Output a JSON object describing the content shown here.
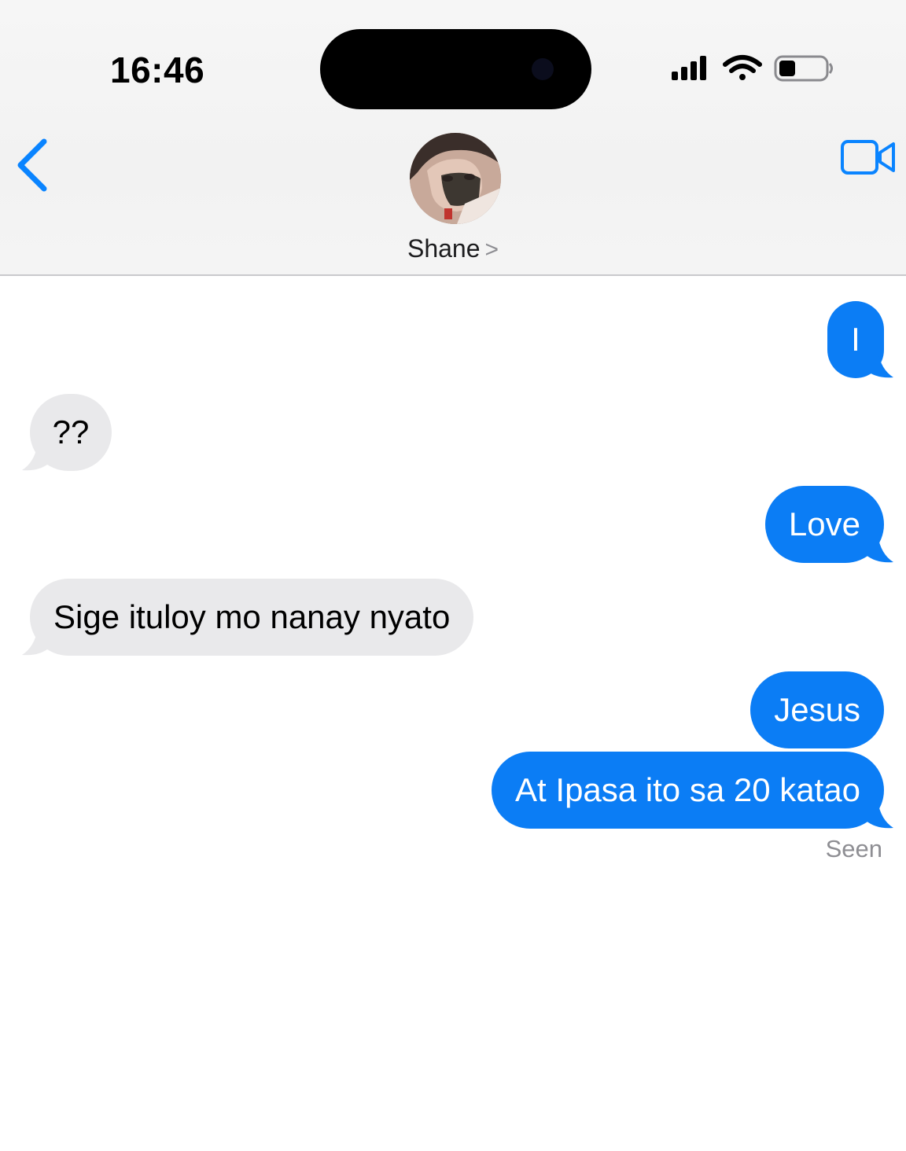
{
  "status_bar": {
    "time": "16:46",
    "signal_icon": "cellular-signal-icon",
    "wifi_icon": "wifi-icon",
    "battery_icon": "battery-low-icon"
  },
  "header": {
    "back_icon": "chevron-left-icon",
    "video_icon": "video-camera-icon",
    "contact_name": "Shane",
    "contact_chevron": ">"
  },
  "messages": [
    {
      "from": "me",
      "text": "I"
    },
    {
      "from": "them",
      "text": "??"
    },
    {
      "from": "me",
      "text": "Love"
    },
    {
      "from": "them",
      "text": "Sige ituloy mo nanay nyato"
    },
    {
      "from": "me",
      "text": "Jesus"
    },
    {
      "from": "me",
      "text": "At Ipasa ito sa 20 katao"
    }
  ],
  "receipt": "Seen",
  "colors": {
    "sent_bubble": "#0b7df5",
    "received_bubble": "#e9e9eb",
    "accent": "#0a84ff"
  }
}
